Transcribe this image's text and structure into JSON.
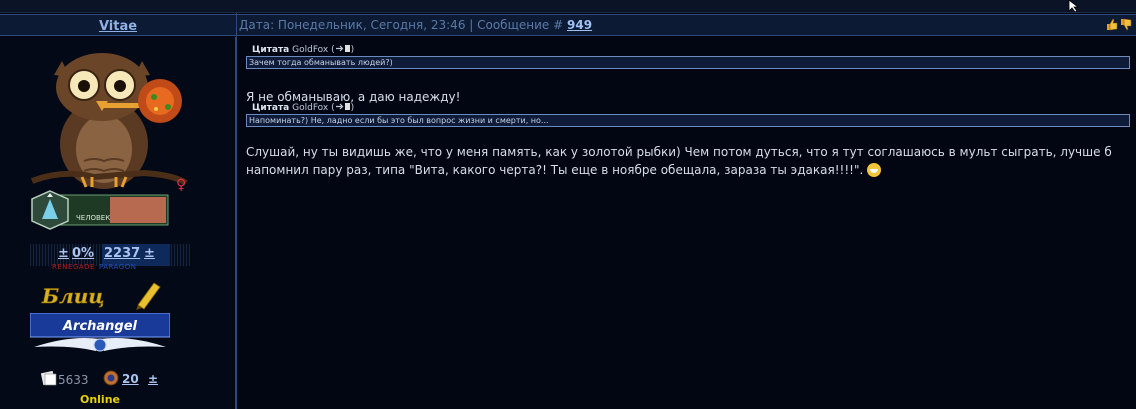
{
  "user": {
    "name": "Vitae",
    "gender_symbol": "♀",
    "rank_label": "ЧЕЛОВЕК",
    "renegade_value": "0%",
    "paragon_value": "2237",
    "plus_sign": "±",
    "renegade_label": "RENEGADE",
    "paragon_label": "PARAGON",
    "award_text": "Блиц",
    "banner_text": "Archangel",
    "post_count": "5633",
    "medal_count": "20",
    "plus": "±",
    "status": "Online"
  },
  "header": {
    "date_text": "Дата: Понедельник, Сегодня, 23:46 | Сообщение #",
    "message_number": "949"
  },
  "post": {
    "quote1": {
      "label": "Цитата",
      "author": "GoldFox (",
      "text": "Зачем тогда обманывать людей?)"
    },
    "reply1": "Я не обманываю, а даю надежду!",
    "quote2": {
      "label": "Цитата",
      "author": "GoldFox (",
      "text": "Напоминать?) Не, ладно если бы это был вопрос жизни и смерти, но..."
    },
    "reply2_line1": "Слушай, ну ты видишь же, что у меня память, как у золотой рыбки) Чем потом дуться, что я тут соглашаюсь в мульт сыграть, лучше б",
    "reply2_line2": "напомнил пару раз, типа \"Вита, какого черта?! Ты еще в ноябре обещала, зараза ты эдакая!!!!\"."
  },
  "icons": {
    "thumb_up": "thumb-up-icon",
    "thumb_down": "thumb-down-icon",
    "smiley": "grin-smiley-icon"
  }
}
